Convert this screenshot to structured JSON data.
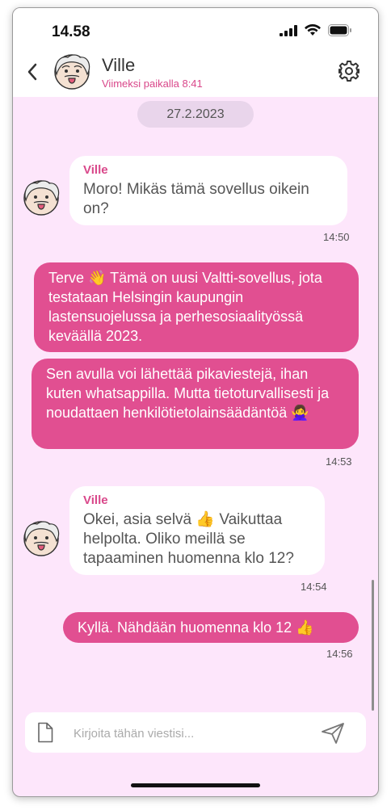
{
  "status_bar": {
    "time": "14.58"
  },
  "header": {
    "contact_name": "Ville",
    "last_seen": "Viimeksi paikalla 8:41",
    "icons": {
      "back": "chevron-left-icon",
      "settings": "gear-icon",
      "avatar": "einstein-emoji-avatar"
    }
  },
  "date_separator": "27.2.2023",
  "messages": [
    {
      "direction": "in",
      "sender": "Ville",
      "text": "Moro! Mikäs tämä sovellus oikein on?",
      "time": "14:50"
    },
    {
      "direction": "out",
      "text": "Terve 👋 Tämä on uusi Valtti-sovellus, jota testataan Helsingin kaupungin lastensuojelussa ja perhesosiaalityössä keväällä 2023."
    },
    {
      "direction": "out",
      "text": "Sen avulla voi lähettää pikaviestejä, ihan kuten whatsappilla. Mutta tietoturvallisesti ja noudattaen henkilötietolainsäädäntöä 🙅‍♀️",
      "time": "14:53"
    },
    {
      "direction": "in",
      "sender": "Ville",
      "text": "Okei, asia selvä 👍 Vaikuttaa helpolta. Oliko meillä se tapaaminen huomenna klo 12?",
      "time": "14:54"
    },
    {
      "direction": "out",
      "text": "Kyllä. Nähdään huomenna klo 12 👍",
      "time": "14:56"
    }
  ],
  "composer": {
    "placeholder": "Kirjoita tähän viestisi...",
    "value": "",
    "icons": {
      "attach": "file-icon",
      "send": "send-icon"
    }
  },
  "colors": {
    "accent": "#e14f91",
    "chat_background": "#fde6fb",
    "sender_name": "#d9478a",
    "date_pill": "#e9d5eb"
  }
}
